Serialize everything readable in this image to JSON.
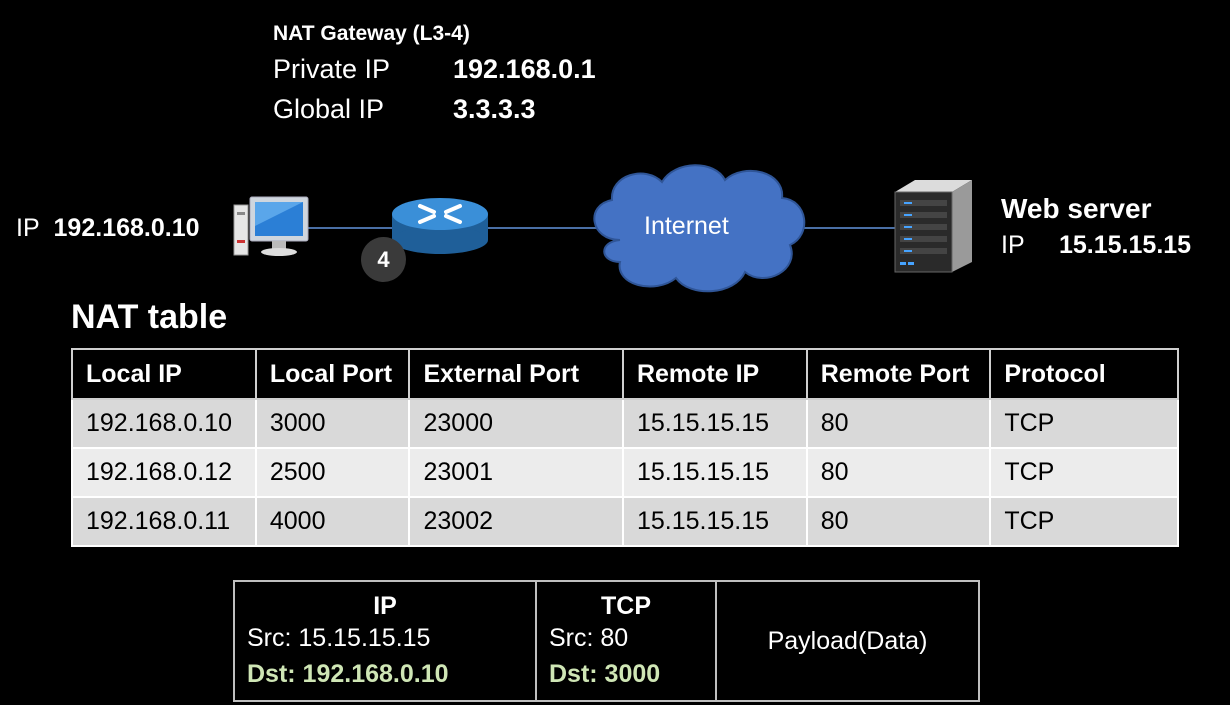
{
  "gateway": {
    "title": "NAT Gateway (L3-4)",
    "private_label": "Private IP",
    "private_value": "192.168.0.1",
    "global_label": "Global IP",
    "global_value": "3.3.3.3"
  },
  "host": {
    "ip_label": "IP",
    "ip_value": "192.168.0.10"
  },
  "step_badge": "4",
  "internet_label": "Internet",
  "webserver": {
    "title": "Web server",
    "ip_label": "IP",
    "ip_value": "15.15.15.15"
  },
  "nat_table": {
    "title": "NAT table",
    "headers": [
      "Local IP",
      "Local Port",
      "External Port",
      "Remote IP",
      "Remote Port",
      "Protocol"
    ],
    "rows": [
      [
        "192.168.0.10",
        "3000",
        "23000",
        "15.15.15.15",
        "80",
        "TCP"
      ],
      [
        "192.168.0.12",
        "2500",
        "23001",
        "15.15.15.15",
        "80",
        "TCP"
      ],
      [
        "192.168.0.11",
        "4000",
        "23002",
        "15.15.15.15",
        "80",
        "TCP"
      ]
    ]
  },
  "packet": {
    "ip_header": "IP",
    "ip_src": "Src: 15.15.15.15",
    "ip_dst": "Dst: 192.168.0.10",
    "tcp_header": "TCP",
    "tcp_src": "Src: 80",
    "tcp_dst": "Dst: 3000",
    "payload": "Payload(Data)"
  },
  "colors": {
    "background": "#000000",
    "router_blue": "#2e7fc4",
    "cloud_blue": "#3e6fbe",
    "dst_highlight": "#cfe6b5"
  }
}
